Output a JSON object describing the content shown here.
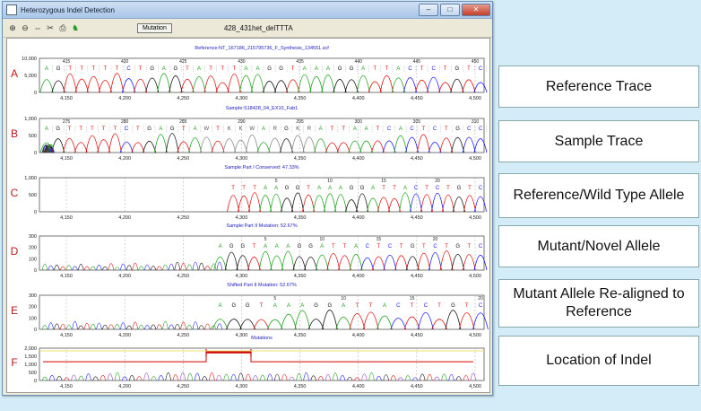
{
  "window": {
    "title": "Heterozygous Indel Detection",
    "minimize": "–",
    "maximize": "□",
    "close": "✕"
  },
  "toolbar": {
    "tools": [
      "zoom-in-icon",
      "zoom-out-icon",
      "zoom-fit-icon",
      "tools-icon",
      "print-icon",
      "run-icon"
    ],
    "mutation_label": "Mutation",
    "file_label": "428_431het_delTTTA"
  },
  "panels": [
    {
      "letter": "A",
      "title": "Reference:NT_167186_215795736_F_Synthesis_134551.scf",
      "yticks": [
        "10,000",
        "5,000",
        "0"
      ],
      "bases": "AGTTTTTCTGAGTATTTAAGGTAAAGGATTACTCTGTC",
      "positions": [
        "415",
        "420",
        "425",
        "430",
        "435",
        "440",
        "445",
        "450"
      ]
    },
    {
      "letter": "B",
      "title": "Sample:S18428_04_EX10_Fab1",
      "yticks": [
        "1,000",
        "500",
        "0"
      ],
      "bases": "AGTTTTTCTGAGTAWTKKWARGKRATTAATCACTCTGCC",
      "positions": [
        "275",
        "280",
        "285",
        "290",
        "295",
        "300",
        "305",
        "310"
      ]
    },
    {
      "letter": "C",
      "title": "Sample:Part I Conserved: 47.33%",
      "yticks": [
        "1,000",
        "500",
        "0"
      ],
      "bases": "TTTAAGGTAAAGGATTACTCTGTC",
      "positions": [
        "5",
        "10",
        "15",
        "20"
      ]
    },
    {
      "letter": "D",
      "title": "Sample:Part II Mutation: 52.67%",
      "yticks": [
        "300",
        "200",
        "100",
        "0"
      ],
      "bases": "AGGTAAAGGATTACTCTGTCTGTC",
      "positions": [
        "5",
        "10",
        "15",
        "20"
      ]
    },
    {
      "letter": "E",
      "title": "Shifted Part II Mutation: 52.67%",
      "yticks": [
        "300",
        "200",
        "100",
        "0"
      ],
      "bases": "AGGTAAAGGATTACTCTGTC",
      "positions": [
        "5",
        "10",
        "15",
        "20"
      ]
    },
    {
      "letter": "F",
      "title": "Mutations",
      "yticks": [
        "2,000",
        "1,500",
        "1,000",
        "500",
        "0"
      ],
      "bases": "",
      "positions": []
    }
  ],
  "xticks": [
    "4,150",
    "4,200",
    "4,250",
    "4,300",
    "4,350",
    "4,400",
    "4,450",
    "4,500"
  ],
  "labels": [
    "Reference Trace",
    "Sample Trace",
    "Reference/Wild Type Allele",
    "Mutant/Novel Allele",
    "Mutant Allele Re-aligned to Reference",
    "Location of Indel"
  ],
  "colors": {
    "A": "#1aa51a",
    "C": "#1a1aff",
    "G": "#111111",
    "T": "#e01010",
    "letter": "#c01818",
    "title": "#2020c0",
    "indel": "#d00000"
  }
}
